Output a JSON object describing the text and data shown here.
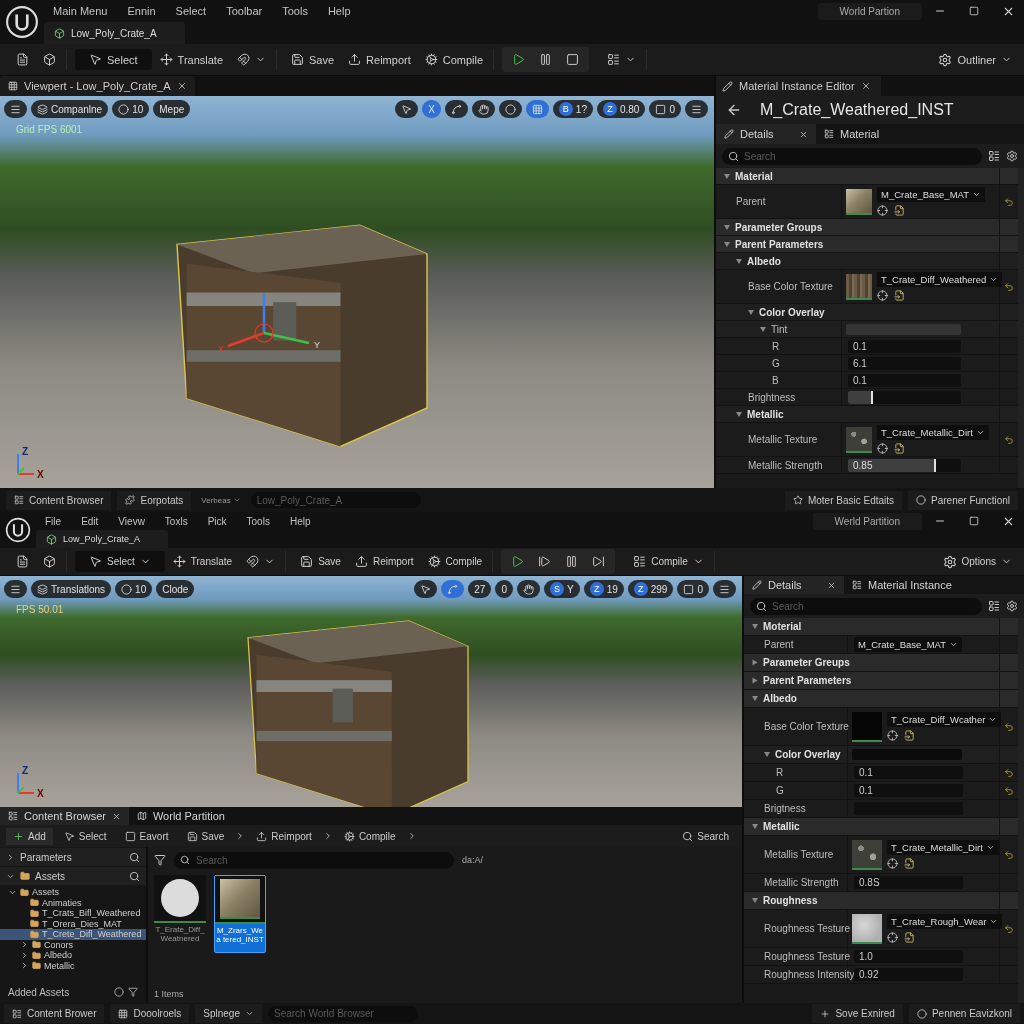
{
  "top": {
    "menu": [
      "Main Menu",
      "Ennin",
      "Select",
      "Toolbar",
      "Tools",
      "Help"
    ],
    "partition_label": "World Partion",
    "document_tab": "Low_Poly_Crate_A",
    "toolbar": {
      "groups": [
        {
          "kind": "plain",
          "items": [
            {
              "kind": "page"
            },
            {
              "kind": "cube"
            }
          ]
        },
        {
          "kind": "plain",
          "items": [
            {
              "kind": "select",
              "label": "Select",
              "selected": true
            },
            {
              "kind": "translate",
              "label": "Translate",
              "selected": false
            },
            {
              "kind": "snap",
              "dropdown": true
            }
          ]
        },
        {
          "kind": "plain",
          "items": [
            {
              "kind": "save",
              "label": "Save"
            },
            {
              "kind": "reimport",
              "label": "Reimport"
            },
            {
              "kind": "compile",
              "label": "Compile"
            }
          ]
        },
        {
          "kind": "playback",
          "items": [
            {
              "kind": "play"
            },
            {
              "kind": "pause"
            },
            {
              "kind": "stop"
            }
          ]
        },
        {
          "kind": "plain",
          "items": [
            {
              "kind": "layout",
              "dropdown": true
            }
          ]
        }
      ],
      "right": {
        "kind": "outliner",
        "label": "Outliner",
        "dropdown": true
      }
    },
    "viewport": {
      "tab": "Viewpert - Low_Poly_Crate_A",
      "stats": "Grid FPS 6001",
      "left_chips": [
        {
          "kind": "menu"
        },
        {
          "kind": "mode",
          "label": "Companlne"
        },
        {
          "kind": "count",
          "label": "10"
        },
        {
          "kind": "text",
          "label": "Mepe"
        }
      ],
      "right_chips": [
        {
          "kind": "pointer",
          "selected": false
        },
        {
          "kind": "letter",
          "label": "X",
          "selected": true
        },
        {
          "kind": "curve",
          "selected": false
        },
        {
          "kind": "hand",
          "selected": false
        },
        {
          "kind": "circle",
          "selected": false
        },
        {
          "kind": "grid",
          "selected": true
        },
        {
          "kind": "value",
          "badge": "B",
          "label": "1?",
          "selected": false
        },
        {
          "kind": "value",
          "badge": "Z",
          "label": "0.80",
          "selected": false
        },
        {
          "kind": "square",
          "label": "0",
          "selected": false
        },
        {
          "kind": "menu",
          "selected": false
        }
      ],
      "gizmo": [
        "X",
        "Y"
      ],
      "axes": [
        "Z",
        "X"
      ]
    },
    "details": {
      "editor_tab": "Material Instance Editor",
      "title": "M_Crate_Weathered_INST",
      "tabs": [
        {
          "label": "Details",
          "selected": true
        },
        {
          "label": "Material",
          "selected": false
        }
      ],
      "search_placeholder": "Search",
      "rows": [
        {
          "kind": "section",
          "label": "Material",
          "expanded": true,
          "children": [
            {
              "kind": "asset",
              "label": "Parent",
              "value": "M_Crate_Base_MAT",
              "thumbnail": {
                "kind": "crate"
              },
              "reset": true
            }
          ]
        },
        {
          "kind": "section",
          "label": "Parameter Groups",
          "expanded": true
        },
        {
          "kind": "section",
          "label": "Parent Parameters",
          "expanded": true,
          "children": [
            {
              "kind": "section",
              "label": "Albedo",
              "expanded": true,
              "children": [
                {
                  "kind": "asset",
                  "label": "Base Color Texture",
                  "value": "T_Crate_Diff_Weathered",
                  "thumbnail": {
                    "kind": "wood"
                  },
                  "reset": true
                },
                {
                  "kind": "section",
                  "label": "Color Overlay",
                  "expanded": true,
                  "children": [
                    {
                      "kind": "section",
                      "label": "Tint",
                      "expanded": true,
                      "swatch": true,
                      "children": [
                        {
                          "kind": "number",
                          "label": "R",
                          "value": "0.1",
                          "reset": false
                        },
                        {
                          "kind": "number",
                          "label": "G",
                          "value": "6.1",
                          "reset": false
                        },
                        {
                          "kind": "number",
                          "label": "B",
                          "value": "0.1",
                          "reset": false
                        }
                      ]
                    }
                  ]
                },
                {
                  "kind": "slider",
                  "label": "Brightness",
                  "level": 0.22
                }
              ]
            },
            {
              "kind": "section",
              "label": "Metallic",
              "expanded": true,
              "children": [
                {
                  "kind": "asset",
                  "label": "Metallic Texture",
                  "value": "T_Crate_Metallic_Dirt",
                  "thumbnail": {
                    "kind": "speckle"
                  },
                  "reset": true
                },
                {
                  "kind": "slider",
                  "label": "Metallic Strength",
                  "value": "0.85",
                  "level": 0.78
                }
              ]
            }
          ]
        }
      ]
    },
    "dock": {
      "tabs": [
        "Content Browser",
        "Eorpotats"
      ],
      "dropdown": "Verbeas",
      "search_placeholder": "Low_Poly_Crate_A",
      "right": [
        "Moter Basic Edtaits",
        "Parener Functionl"
      ]
    }
  },
  "bottom": {
    "menu": [
      "File",
      "Edit",
      "Vievw",
      "Toxls",
      "Pick",
      "Tools",
      "Help"
    ],
    "partition_label": "Werld Partition",
    "document_tab": "Low_Poly_Crate_A",
    "toolbar": {
      "groups": [
        {
          "kind": "plain",
          "items": [
            {
              "kind": "page"
            },
            {
              "kind": "cube"
            }
          ]
        },
        {
          "kind": "plain",
          "items": [
            {
              "kind": "select",
              "label": "Select",
              "selected": true,
              "dropdown": true
            },
            {
              "kind": "translate",
              "label": "Translate",
              "selected": false
            },
            {
              "kind": "snap",
              "dropdown": true
            }
          ]
        },
        {
          "kind": "plain",
          "items": [
            {
              "kind": "save",
              "label": "Save"
            },
            {
              "kind": "reimport",
              "label": "Reimport"
            },
            {
              "kind": "compile",
              "label": "Compile"
            }
          ]
        },
        {
          "kind": "playback",
          "items": [
            {
              "kind": "play"
            },
            {
              "kind": "step"
            },
            {
              "kind": "pause"
            },
            {
              "kind": "skip"
            }
          ]
        },
        {
          "kind": "plain",
          "items": [
            {
              "kind": "layout",
              "label": "Compile",
              "dropdown": true
            }
          ]
        }
      ],
      "right": {
        "kind": "options",
        "label": "Options",
        "dropdown": true
      }
    },
    "viewport": {
      "stats": "FPS 50.01",
      "left_chips": [
        {
          "kind": "menu"
        },
        {
          "kind": "mode",
          "label": "Translatlons"
        },
        {
          "kind": "count",
          "label": "10"
        },
        {
          "kind": "text",
          "label": "Clode"
        }
      ],
      "right_chips": [
        {
          "kind": "pointer",
          "selected": false
        },
        {
          "kind": "curve",
          "selected": true
        },
        {
          "kind": "letter",
          "label": "27",
          "selected": false
        },
        {
          "kind": "letter",
          "label": "0",
          "selected": false
        },
        {
          "kind": "hand",
          "selected": false
        },
        {
          "kind": "value",
          "badge": "S",
          "label": "Y",
          "selected": false
        },
        {
          "kind": "value",
          "badge": "Z",
          "label": "19",
          "selected": false
        },
        {
          "kind": "value",
          "badge": "Z",
          "label": "299",
          "selected": false
        },
        {
          "kind": "square",
          "label": "0",
          "selected": false
        },
        {
          "kind": "menu",
          "selected": false
        }
      ],
      "axes": [
        "Z",
        "X"
      ]
    },
    "content_browser": {
      "tabs": [
        {
          "label": "Content Browser",
          "selected": true
        },
        {
          "label": "World Partition",
          "selected": false
        }
      ],
      "actions": [
        {
          "kind": "add",
          "label": "Add"
        },
        {
          "kind": "select",
          "label": "Select"
        },
        {
          "kind": "favorite",
          "label": "Eavort"
        },
        {
          "kind": "save",
          "label": "Save",
          "chevron": true
        },
        {
          "kind": "reimport",
          "label": "Reimport",
          "chevron": true
        },
        {
          "kind": "compile",
          "label": "Compile",
          "chevron": true
        }
      ],
      "search_button": "Search",
      "sources": [
        {
          "label": "Parameters",
          "expanded": false
        },
        {
          "label": "Assets",
          "expanded": true
        }
      ],
      "tree": [
        {
          "label": "Assets",
          "expanded": true,
          "selected": false,
          "children": [
            {
              "label": "Animaties",
              "selected": false
            },
            {
              "label": "T_Crats_Bifl_Weathered",
              "selected": false
            },
            {
              "label": "T_Orera_Dies_MAT",
              "selected": false
            },
            {
              "label": "T_Crete_Difl_Weathered",
              "selected": true
            },
            {
              "label": "Conors",
              "expanded": false,
              "selected": false
            },
            {
              "label": "Albedo",
              "expanded": false,
              "selected": false
            },
            {
              "label": "Metallic",
              "expanded": false,
              "selected": false
            }
          ]
        }
      ],
      "footer": "Added Assets",
      "search_placeholder": "Search",
      "filter_hint": "da:A/",
      "assets": [
        {
          "label": "T_Erate_Diff_ Weatnered",
          "thumbnail": {
            "kind": "sphere"
          },
          "selected": false
        },
        {
          "label": "M_Zrars_Wea tered_INST",
          "thumbnail": {
            "kind": "crate"
          },
          "selected": true
        }
      ],
      "count": "1 Items"
    },
    "details": {
      "tabs": [
        {
          "label": "Details",
          "selected": true
        },
        {
          "label": "Material Instance",
          "selected": false
        }
      ],
      "search_placeholder": "Search",
      "rows": [
        {
          "kind": "section",
          "label": "Moterial",
          "expanded": true,
          "children": [
            {
              "kind": "dropdown",
              "label": "Parent",
              "value": "M_Crate_Base_MAT",
              "reset": false
            }
          ]
        },
        {
          "kind": "section",
          "label": "Parameter Greups",
          "expanded": false
        },
        {
          "kind": "section",
          "label": "Parent Parameters",
          "expanded": false
        },
        {
          "kind": "section",
          "label": "Albedo",
          "expanded": true,
          "children": [
            {
              "kind": "asset",
              "label": "Base Color Texture",
              "value": "T_Crate_Diff_Wcather",
              "thumbnail": {
                "kind": "black"
              },
              "reset": true
            },
            {
              "kind": "section",
              "label": "Color Overlay",
              "expanded": true,
              "swatch": true,
              "children": [
                {
                  "kind": "number",
                  "label": "R",
                  "value": "0.1",
                  "reset": true
                },
                {
                  "kind": "number",
                  "label": "G",
                  "value": "0.1",
                  "reset": true
                }
              ]
            },
            {
              "kind": "field",
              "label": "Brigtness"
            }
          ]
        },
        {
          "kind": "section",
          "label": "Metallic",
          "expanded": true,
          "children": [
            {
              "kind": "asset",
              "label": "Metallis Texture",
              "value": "T_Crate_Metallic_Dirt",
              "thumbnail": {
                "kind": "speckle"
              },
              "reset": true
            },
            {
              "kind": "number",
              "label": "Metallic Strength",
              "value": "0.8S",
              "reset": false
            }
          ]
        },
        {
          "kind": "section",
          "label": "Roughness",
          "expanded": true,
          "children": [
            {
              "kind": "asset",
              "label": "Roughness Testure",
              "value": "T_Crate_Rough_Wear",
              "thumbnail": {
                "kind": "noise"
              },
              "reset": true
            },
            {
              "kind": "number",
              "label": "Roughness Testure",
              "value": "1.0",
              "reset": false
            },
            {
              "kind": "number",
              "label": "Roughness Intensity",
              "value": "0.92",
              "reset": false
            }
          ]
        }
      ]
    },
    "status": {
      "items": [
        {
          "kind": "tab",
          "label": "Content Brower"
        },
        {
          "kind": "tab",
          "label": "Dooolroels"
        },
        {
          "kind": "dropdown",
          "label": "Splnege"
        }
      ],
      "search_placeholder": "Search World Browser",
      "right": [
        "Sove Exnired",
        "Pennen Eavizkonl"
      ]
    }
  }
}
